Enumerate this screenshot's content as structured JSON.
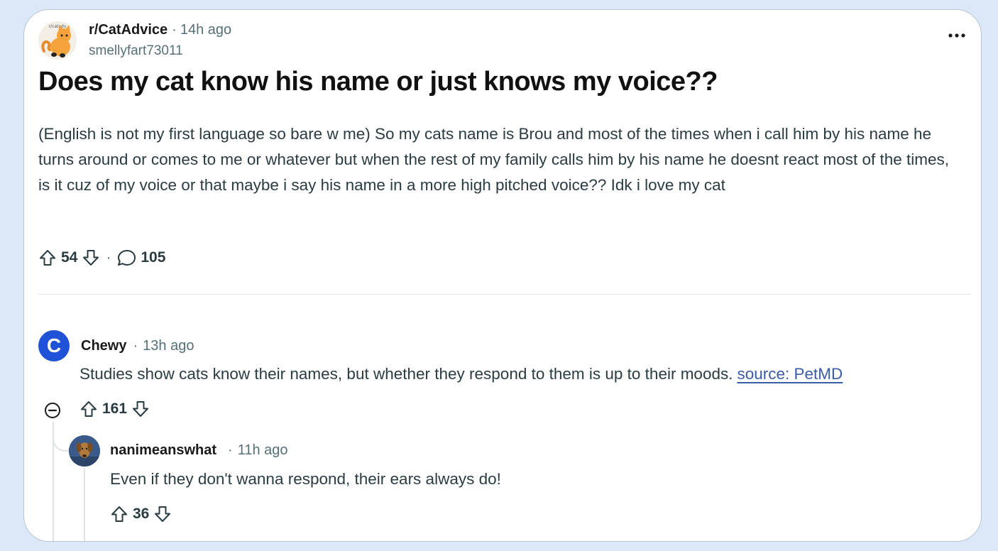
{
  "post": {
    "subreddit": "r/CatAdvice",
    "separator": "·",
    "time": "14h ago",
    "author": "smellyfart73011",
    "title": "Does my cat know his name or just knows my voice??",
    "body": "(English is not my first language so bare w me) So my cats name is Brou and most of the times when i call him by his name he turns around or comes to me or whatever but when the rest of my family calls him by his name he doesnt react most of the times, is it cuz of my voice or that maybe i say his name in a more high pitched voice?? Idk i love my cat",
    "upvotes": "54",
    "comments": "105",
    "more_icon": "ellipsis-icon",
    "subreddit_avatar_text": "r/catadv"
  },
  "comments": [
    {
      "avatar_letter": "C",
      "author": "Chewy",
      "separator": "·",
      "time": "13h ago",
      "text": "Studies show cats know their names, but whether they respond to them is up to their moods.",
      "link_text": "source: PetMD",
      "upvotes": "161",
      "avatar_color": "#1f52d6"
    },
    {
      "author": "nanimeanswhat",
      "separator": "·",
      "time": "11h ago",
      "text": "Even if they don't wanna respond, their ears always do!",
      "upvotes": "36"
    }
  ],
  "colors": {
    "background": "#dce8f7",
    "card": "#ffffff",
    "muted_text": "#576f76",
    "link": "#3b5ba9"
  }
}
